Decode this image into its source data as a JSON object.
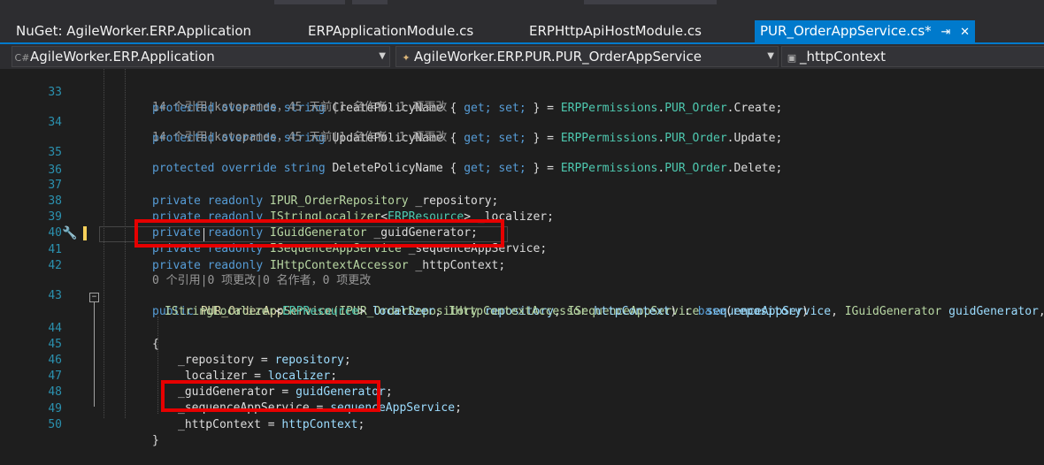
{
  "tabs": [
    {
      "label": "NuGet: AgileWorker.ERP.Application",
      "active": false
    },
    {
      "label": "ERPApplicationModule.cs",
      "active": false
    },
    {
      "label": "ERPHttpApiHostModule.cs",
      "active": false
    },
    {
      "label": "PUR_OrderAppService.cs*",
      "active": true
    }
  ],
  "tab_icons": {
    "pin": "pin-icon",
    "close": "close-icon"
  },
  "navbar": {
    "project": "AgileWorker.ERP.Application",
    "class": "AgileWorker.ERP.PUR.PUR_OrderAppService",
    "member": "_httpContext"
  },
  "lens": {
    "line34": "14 个引用|kstopames，45 天前|1 名作者，1 项更改",
    "line35": "14 个引用|kstopames，45 天前|1 名作者，1 项更改",
    "line43": "0 个引用|0 项更改|0 名作者，0 项更改"
  },
  "line_numbers": [
    "33",
    "34",
    "35",
    "36",
    "37",
    "38",
    "39",
    "40",
    "41",
    "42",
    "43",
    "44",
    "45",
    "46",
    "47",
    "48",
    "49",
    "50"
  ],
  "code": {
    "l33": {
      "kw": "protected override string",
      "name": " CreatePolicyName { ",
      "acc": "get; set;",
      "mid": " } = ",
      "cls": "ERPPermissions",
      "dot": ".",
      "cls2": "PUR_Order",
      "tail": ".Create;"
    },
    "l34": {
      "kw": "protected override string",
      "name": " UpdatePolicyName { ",
      "acc": "get; set;",
      "mid": " } = ",
      "cls": "ERPPermissions",
      "dot": ".",
      "cls2": "PUR_Order",
      "tail": ".Update;"
    },
    "l35": {
      "kw": "protected override string",
      "name": " DeletePolicyName { ",
      "acc": "get; set;",
      "mid": " } = ",
      "cls": "ERPPermissions",
      "dot": ".",
      "cls2": "PUR_Order",
      "tail": ".Delete;"
    },
    "l37": {
      "kw": "private readonly",
      "type": " IPUR_OrderRepository",
      "tail": " _repository;"
    },
    "l38": {
      "kw": "private readonly",
      "type": " IStringLocalizer",
      "lt": "<",
      "cls": "ERPResource",
      "tail": "> _localizer;"
    },
    "l39": {
      "kw": "private readonly",
      "type": " IGuidGenerator",
      "tail": " _guidGenerator;"
    },
    "l40": {
      "kw": "private readonly",
      "type": " ISequenceAppService",
      "tail": " _sequenceAppService;"
    },
    "l41": {
      "kw": "private readonly",
      "type": " IHttpContextAccessor",
      "tail": " _httpContext;"
    },
    "l43a": {
      "kw": "public",
      "ctor": " PUR_OrderAppService",
      "p1": "(IPUR_OrderRepository",
      "n1": " repository",
      "c1": ", ",
      "t2": "ISequenceAppService",
      "n2": " sequenceAppService",
      "c2": ", ",
      "t3": "IGuidGenerator",
      "n3": " guidGenerator",
      "c3": ","
    },
    "l43b": {
      "t4": "IStringLocalizer",
      "lt": "<",
      "cls": "ERPResource",
      "gt": "> ",
      "n4": "localizer",
      "c4": ", ",
      "t5": "IHttpContextAccessor",
      "n5": " httpContext",
      "tail": ") : ",
      "base": "base",
      "open": "(",
      "arg": "repository",
      "close": ")"
    },
    "l44": "{",
    "l45": {
      "lhs": "_repository = ",
      "rhs": "repository",
      "end": ";"
    },
    "l46": {
      "lhs": "_localizer = ",
      "rhs": "localizer",
      "end": ";"
    },
    "l47": {
      "lhs": "_guidGenerator = ",
      "rhs": "guidGenerator",
      "end": ";"
    },
    "l48": {
      "lhs": "_sequenceAppService = ",
      "rhs": "sequenceAppService",
      "end": ";"
    },
    "l49": {
      "lhs": "_httpContext = ",
      "rhs": "httpContext",
      "end": ";"
    },
    "l50": "}"
  },
  "colors": {
    "keyword": "#569cd6",
    "type": "#b8d7a3",
    "class": "#4ec9b0",
    "param": "#9cdcfe",
    "highlight_box": "#e60000",
    "accent": "#007acc"
  }
}
